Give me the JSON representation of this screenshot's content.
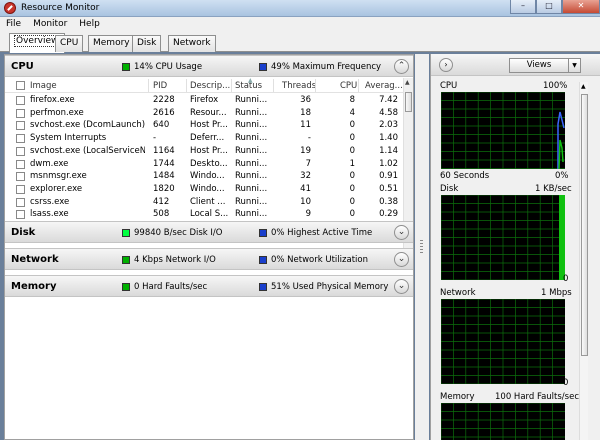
{
  "window": {
    "title": "Resource Monitor",
    "minimize": "–",
    "maximize": "□",
    "close": "✕"
  },
  "menu": [
    "File",
    "Monitor",
    "Help"
  ],
  "tabs": [
    "Overview",
    "CPU",
    "Memory",
    "Disk",
    "Network"
  ],
  "colors": {
    "green": "#00b000",
    "blue": "#1a3fcc",
    "graph_green": "#10c010",
    "graph_blue": "#3a66ff",
    "grid": "#0d6e0d"
  },
  "cpu_section": {
    "title": "CPU",
    "indicator1": "14% CPU Usage",
    "indicator2": "49% Maximum Frequency",
    "columns": [
      "Image",
      "PID",
      "Descrip...",
      "Status",
      "Threads",
      "CPU",
      "Averag..."
    ],
    "rows": [
      [
        "firefox.exe",
        "2228",
        "Firefox",
        "Runni...",
        "36",
        "8",
        "7.42"
      ],
      [
        "perfmon.exe",
        "2616",
        "Resour...",
        "Runni...",
        "18",
        "4",
        "4.58"
      ],
      [
        "svchost.exe (DcomLaunch)",
        "640",
        "Host Pr...",
        "Runni...",
        "11",
        "0",
        "2.03"
      ],
      [
        "System Interrupts",
        "-",
        "Deferr...",
        "Runni...",
        "-",
        "0",
        "1.40"
      ],
      [
        "svchost.exe (LocalServiceNo...",
        "1164",
        "Host Pr...",
        "Runni...",
        "19",
        "0",
        "1.14"
      ],
      [
        "dwm.exe",
        "1744",
        "Deskto...",
        "Runni...",
        "7",
        "1",
        "1.02"
      ],
      [
        "msnmsgr.exe",
        "1484",
        "Windo...",
        "Runni...",
        "32",
        "0",
        "0.91"
      ],
      [
        "explorer.exe",
        "1820",
        "Windo...",
        "Runni...",
        "41",
        "0",
        "0.51"
      ],
      [
        "csrss.exe",
        "412",
        "Client ...",
        "Runni...",
        "10",
        "0",
        "0.38"
      ],
      [
        "lsass.exe",
        "508",
        "Local S...",
        "Runni...",
        "9",
        "0",
        "0.29"
      ]
    ]
  },
  "disk_section": {
    "title": "Disk",
    "indicator1": "99840 B/sec Disk I/O",
    "indicator2": "0% Highest Active Time"
  },
  "network_section": {
    "title": "Network",
    "indicator1": "4 Kbps Network I/O",
    "indicator2": "0% Network Utilization"
  },
  "memory_section": {
    "title": "Memory",
    "indicator1": "0 Hard Faults/sec",
    "indicator2": "51% Used Physical Memory"
  },
  "right_pane": {
    "views_label": "Views",
    "cpu_graph": {
      "label": "CPU",
      "max": "100%",
      "time": "60 Seconds",
      "min": "0%"
    },
    "disk_graph": {
      "label": "Disk",
      "max": "1 KB/sec",
      "min": "0"
    },
    "network_graph": {
      "label": "Network",
      "max": "1 Mbps",
      "min": "0"
    },
    "memory_graph": {
      "label": "Memory",
      "max": "100 Hard Faults/sec"
    }
  }
}
